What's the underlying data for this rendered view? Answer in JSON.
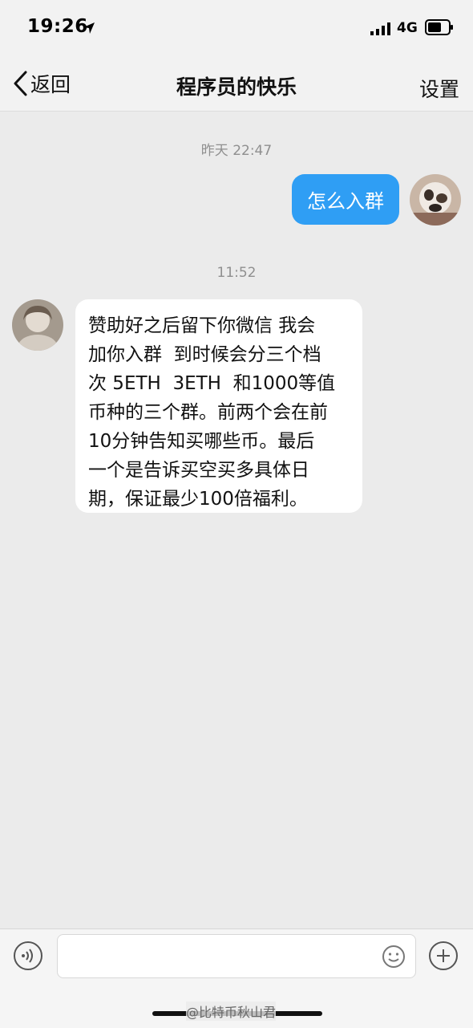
{
  "status_bar": {
    "time": "19:26",
    "network": "4G"
  },
  "nav": {
    "back_label": "返回",
    "title": "程序员的快乐",
    "settings_label": "设置"
  },
  "messages": {
    "timestamp1": "昨天 22:47",
    "outgoing_text": "怎么入群",
    "timestamp2": "11:52",
    "incoming_lines": [
      "赞助好之后留下你微信 我会",
      "加你入群  到时候会分三个档",
      "次 5ETH  3ETH  和1000等值",
      "币种的三个群。前两个会在前",
      "10分钟告知买哪些币。最后",
      "一个是告诉买空买多具体日",
      "期，保证最少100倍福利。"
    ]
  },
  "input": {
    "placeholder": ""
  },
  "watermark": "@比特币秋山君",
  "colors": {
    "bubble_out": "#2f9ef4",
    "bubble_in": "#ffffff",
    "background": "#ebebeb"
  },
  "icons": [
    "location-arrow-icon",
    "signal-icon",
    "battery-icon",
    "back-chevron-icon",
    "voice-icon",
    "emoji-icon",
    "plus-icon"
  ]
}
